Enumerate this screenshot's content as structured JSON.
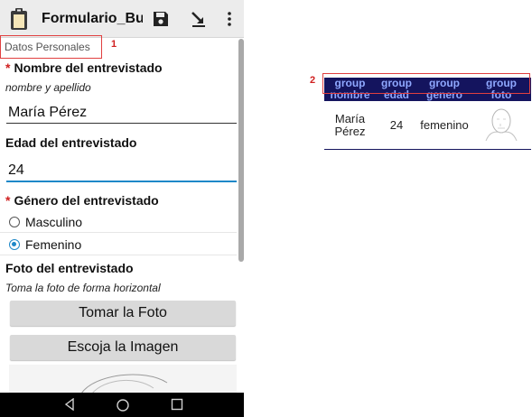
{
  "app": {
    "title": "Formulario_Bu..."
  },
  "group_tag": "Datos Personales",
  "annotations": {
    "first": "1",
    "second": "2"
  },
  "form": {
    "name": {
      "label": "Nombre del entrevistado",
      "hint": "nombre y apellido",
      "value": "María Pérez"
    },
    "age": {
      "label": "Edad del entrevistado",
      "value": "24"
    },
    "gender": {
      "label": "Género del entrevistado",
      "options": [
        {
          "label": "Masculino",
          "selected": false
        },
        {
          "label": "Femenino",
          "selected": true
        }
      ]
    },
    "photo": {
      "label": "Foto del entrevistado",
      "hint": "Toma la foto de forma horizontal",
      "take_button": "Tomar la Foto",
      "choose_button": "Escoja la Imagen"
    },
    "required_marker": "*"
  },
  "table": {
    "group_headers": [
      "group",
      "group",
      "group",
      "group"
    ],
    "field_headers": [
      "nombre",
      "edad",
      "genero",
      "foto"
    ],
    "row": {
      "nombre": "María Pérez",
      "edad": "24",
      "genero": "femenino"
    }
  },
  "colors": {
    "accent": "#1e88c8",
    "required": "#d02020",
    "table_header_bg": "#14145e",
    "table_header_text": "#8fa8ff"
  },
  "icons": [
    "clipboard-icon",
    "save-icon",
    "jump-arrow-icon",
    "overflow-menu-icon",
    "back-icon",
    "home-icon",
    "recents-icon"
  ]
}
